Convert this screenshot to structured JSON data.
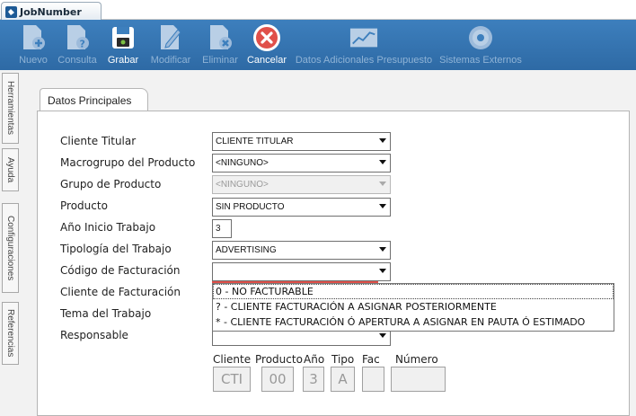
{
  "window": {
    "tab_title": "JobNumber"
  },
  "toolbar": {
    "buttons": [
      {
        "label": "Nuevo",
        "icon": "new-document-icon",
        "enabled": false
      },
      {
        "label": "Consulta",
        "icon": "query-document-icon",
        "enabled": false
      },
      {
        "label": "Grabar",
        "icon": "save-disk-icon",
        "enabled": true
      },
      {
        "label": "Modificar",
        "icon": "edit-pencil-icon",
        "enabled": false
      },
      {
        "label": "Eliminar",
        "icon": "delete-document-icon",
        "enabled": false
      },
      {
        "label": "Cancelar",
        "icon": "cancel-x-icon",
        "enabled": true
      },
      {
        "label": "Datos Adicionales Presupuesto",
        "icon": "chart-icon",
        "enabled": false
      },
      {
        "label": "Sistemas Externos",
        "icon": "external-systems-icon",
        "enabled": false
      }
    ]
  },
  "side_tabs": [
    "Herramientas",
    "Ayuda",
    "Configuraciones",
    "Referencias"
  ],
  "panel": {
    "tab_label": "Datos Principales"
  },
  "fields": {
    "cliente_titular": {
      "label": "Cliente Titular",
      "value": "CLIENTE TITULAR"
    },
    "macrogrupo": {
      "label": "Macrogrupo del Producto",
      "value": "<NINGUNO>"
    },
    "grupo": {
      "label": "Grupo de Producto",
      "value": "<NINGUNO>"
    },
    "producto": {
      "label": "Producto",
      "value": "SIN PRODUCTO"
    },
    "anio_inicio": {
      "label": "Año Inicio Trabajo",
      "value": "3"
    },
    "tipologia": {
      "label": "Tipología del Trabajo",
      "value": "ADVERTISING"
    },
    "codigo_facturacion": {
      "label": "Código de Facturación",
      "value": ""
    },
    "cliente_facturacion": {
      "label": "Cliente de Facturación"
    },
    "tema": {
      "label": "Tema del Trabajo"
    },
    "responsable": {
      "label": "Responsable"
    }
  },
  "dropdown_options": [
    "0 - NO FACTURABLE",
    "? - CLIENTE FACTURACIÓN A ASIGNAR POSTERIORMENTE",
    "* - CLIENTE FACTURACIÓN Ó APERTURA A ASIGNAR EN PAUTA Ó ESTIMADO"
  ],
  "code": {
    "headers": [
      "Cliente",
      "Producto",
      "Año",
      "Tipo",
      "Fac",
      "Número"
    ],
    "values": [
      "CTI",
      "00",
      "3",
      "A",
      "",
      ""
    ]
  },
  "colors": {
    "toolbar": "#3d7fbd",
    "accent": "#e0504a"
  }
}
